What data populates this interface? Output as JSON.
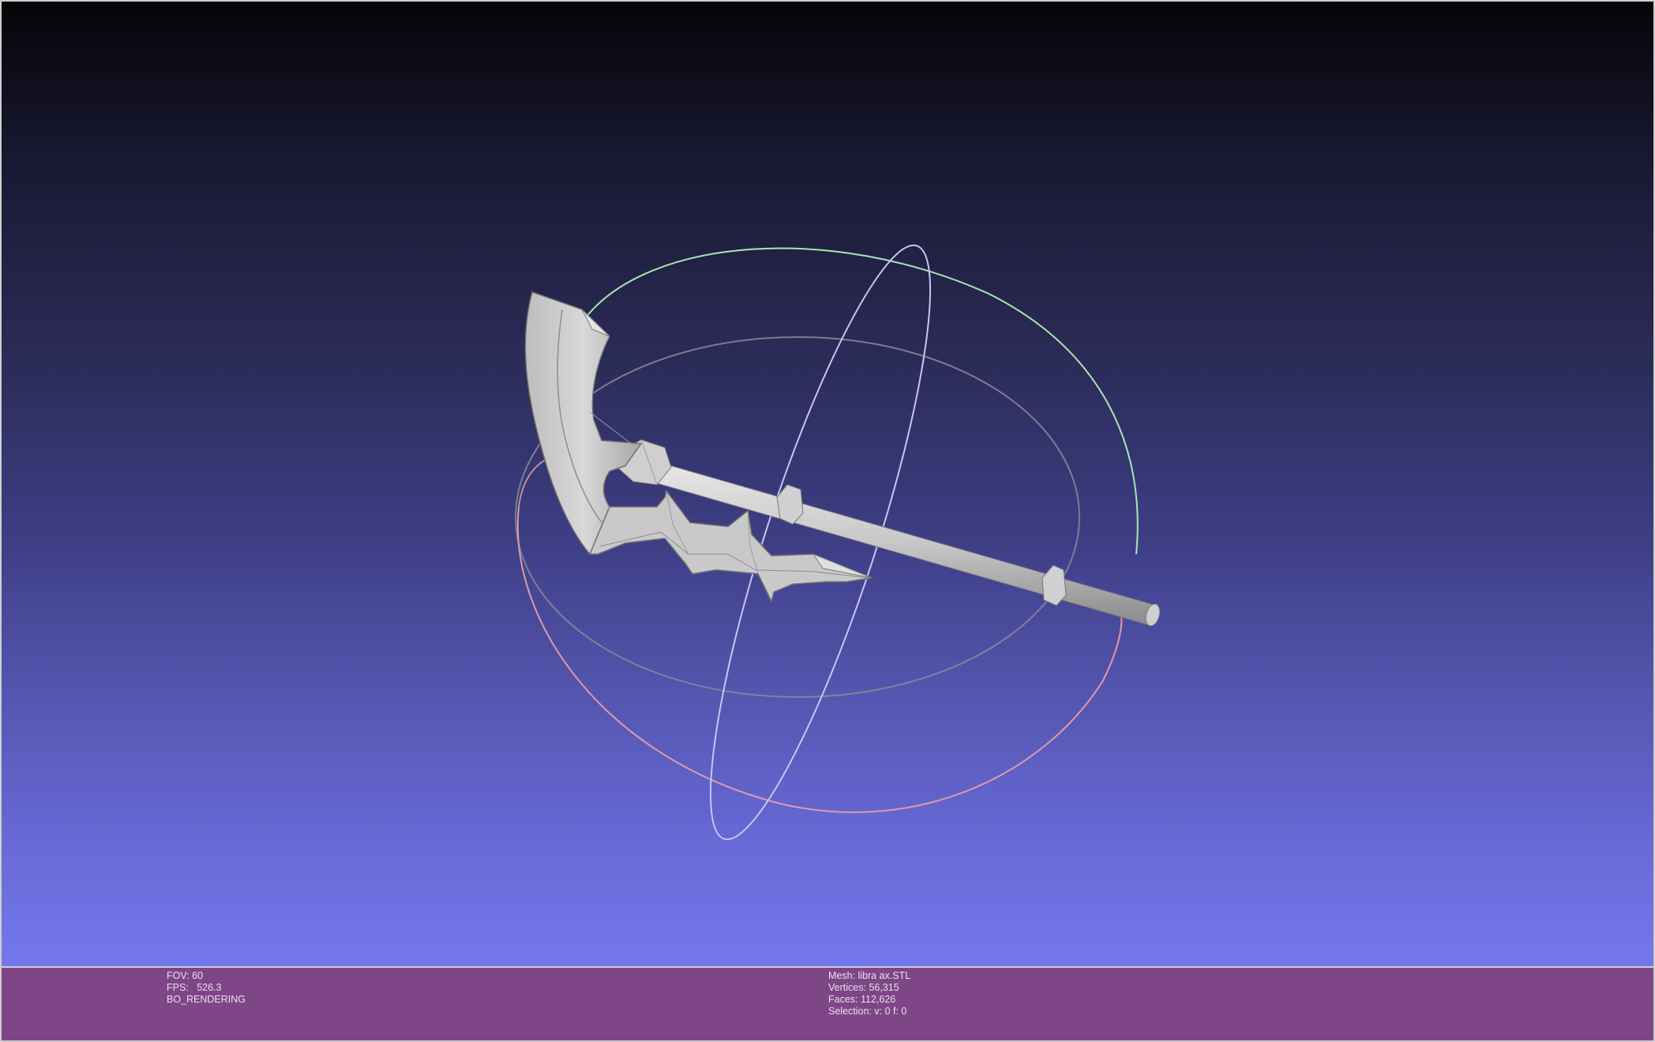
{
  "viewer": {
    "title": "",
    "render_info": {
      "fov": "FOV: 60",
      "fps": "FPS:   526.3",
      "mode": "BO_RENDERING"
    },
    "mesh_info": {
      "mesh": "Mesh: libra ax.STL",
      "vertices": "Vertices: 56,315",
      "faces": "Faces: 112,626",
      "selection": "Selection: v: 0 f: 0"
    }
  },
  "colors": {
    "background_top": "#050508",
    "background_bottom": "#7578ec",
    "info_bar": "#7f4687",
    "info_text": "#e8e0ec",
    "mesh_gray": "#c4c4c4",
    "trackball_green": "#a8e8b0",
    "trackball_red": "#e09aa8",
    "trackball_blue": "#c8c4f4"
  },
  "icons": {
    "trackball": "trackball-gizmo",
    "model": "3d-mesh-axe"
  }
}
